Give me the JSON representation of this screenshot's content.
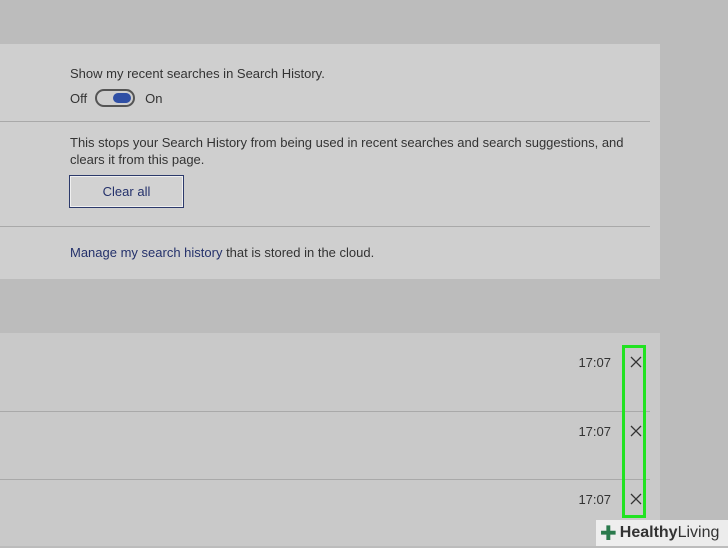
{
  "settings": {
    "history_label": "Show my recent searches in Search History.",
    "toggle_off_label": "Off",
    "toggle_on_label": "On",
    "toggle_state": "on",
    "clear_description": "This stops your Search History from being used in recent searches and search suggestions, and clears it from this page.",
    "clear_button_label": "Clear all",
    "manage_link_text": "Manage my search history",
    "manage_suffix_text": " that is stored in the cloud."
  },
  "history_items": [
    {
      "time": "17:07",
      "close_icon": "close-icon"
    },
    {
      "time": "17:07",
      "close_icon": "close-icon"
    },
    {
      "time": "17:07",
      "close_icon": "close-icon"
    }
  ],
  "watermark": {
    "bold_text": "Healthy",
    "text": " Living"
  },
  "colors": {
    "accent": "#2f4fa5",
    "link": "#24316b",
    "highlight": "#21e321",
    "panel_bg": "#cfcfcf",
    "page_bg": "#bcbcbc"
  }
}
